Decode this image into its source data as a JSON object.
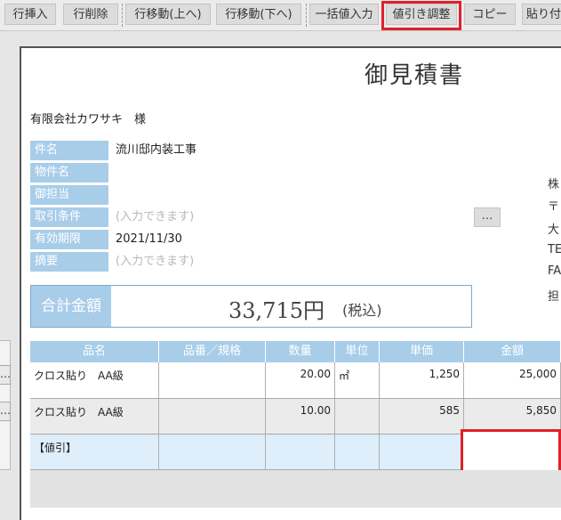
{
  "toolbar": {
    "insert_row": "行挿入",
    "delete_row": "行削除",
    "move_up": "行移動(上へ)",
    "move_down": "行移動(下へ)",
    "bulk_input": "一括値入力",
    "discount_adjust": "値引き調整",
    "copy": "コピー",
    "paste": "貼り付け"
  },
  "document": {
    "title": "御見積書",
    "client": "有限会社カワサキ　様",
    "fields": [
      {
        "label": "件名",
        "value": "流川邸内装工事"
      },
      {
        "label": "物件名",
        "value": ""
      },
      {
        "label": "御担当",
        "value": ""
      },
      {
        "label": "取引条件",
        "value": "(入力できます)"
      },
      {
        "label": "有効期限",
        "value": "2021/11/30"
      },
      {
        "label": "摘要",
        "value": "(入力できます)"
      }
    ],
    "ellipsis": "…",
    "company_lines": [
      "株",
      "〒",
      "大",
      "TE",
      "FA",
      "担"
    ],
    "total": {
      "label": "合計金額",
      "amount": "33,715円",
      "tax": "(税込)"
    }
  },
  "table": {
    "headers": [
      "品名",
      "品番／規格",
      "数量",
      "単位",
      "単価",
      "金額"
    ],
    "rows": [
      {
        "name": "クロス貼り　AA級",
        "spec": "",
        "qty": "20.00",
        "unit": "㎡",
        "price": "1,250",
        "amount": "25,000"
      },
      {
        "name": "クロス貼り　AA級",
        "spec": "",
        "qty": "10.00",
        "unit": "",
        "price": "585",
        "amount": "5,850"
      },
      {
        "name": "【値引】",
        "spec": "",
        "qty": "",
        "unit": "",
        "price": "",
        "amount": ""
      }
    ]
  },
  "left_strip": {
    "dots": "…"
  }
}
